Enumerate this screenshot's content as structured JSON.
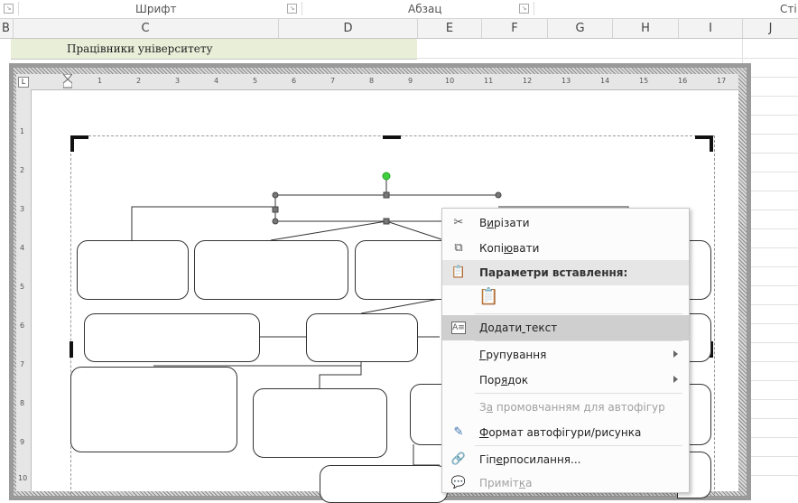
{
  "ribbon": {
    "groups": [
      {
        "label": "Шрифт"
      },
      {
        "label": "Абзац"
      },
      {
        "label": "Сті"
      }
    ]
  },
  "columns": [
    "B",
    "C",
    "D",
    "E",
    "F",
    "G",
    "H",
    "I",
    "J"
  ],
  "sheet": {
    "title_cell": "Працівники університету"
  },
  "ruler": {
    "h_ticks": [
      "1",
      "2",
      "3",
      "4",
      "5",
      "6",
      "7",
      "8",
      "9",
      "10",
      "11",
      "12",
      "13",
      "14",
      "15",
      "16",
      "17"
    ],
    "v_ticks": [
      "1",
      "2",
      "3",
      "4",
      "5",
      "6",
      "7",
      "8",
      "9",
      "10"
    ]
  },
  "context_menu": {
    "items": [
      {
        "label": "Вирізати",
        "mnemonic_index": 1,
        "icon": "scissors-icon",
        "state": "normal"
      },
      {
        "label": "Копіювати",
        "mnemonic_index": 4,
        "icon": "copy-icon",
        "state": "normal"
      },
      {
        "label": "Параметри вставлення:",
        "icon": "paste-icon",
        "state": "header"
      },
      {
        "label": "",
        "icon": "paste-option-icon",
        "state": "normal"
      },
      {
        "label": "Додати текст",
        "mnemonic_index": 6,
        "icon": "text-box-icon",
        "state": "highlighted"
      },
      {
        "label": "Групування",
        "mnemonic_index": 0,
        "icon": "",
        "state": "submenu"
      },
      {
        "label": "Порядок",
        "mnemonic_index": 3,
        "icon": "",
        "state": "submenu"
      },
      {
        "label": "За промовчанням для автофігур",
        "mnemonic_index": 1,
        "icon": "",
        "state": "disabled"
      },
      {
        "label": "Формат автофігури/рисунка",
        "mnemonic_index": 0,
        "icon": "format-shape-icon",
        "state": "normal"
      },
      {
        "label": "Гіперпосилання...",
        "mnemonic_index": 3,
        "icon": "hyperlink-icon",
        "state": "normal"
      },
      {
        "label": "Примітка",
        "mnemonic_index": 6,
        "icon": "comment-icon",
        "state": "disabled"
      }
    ]
  }
}
